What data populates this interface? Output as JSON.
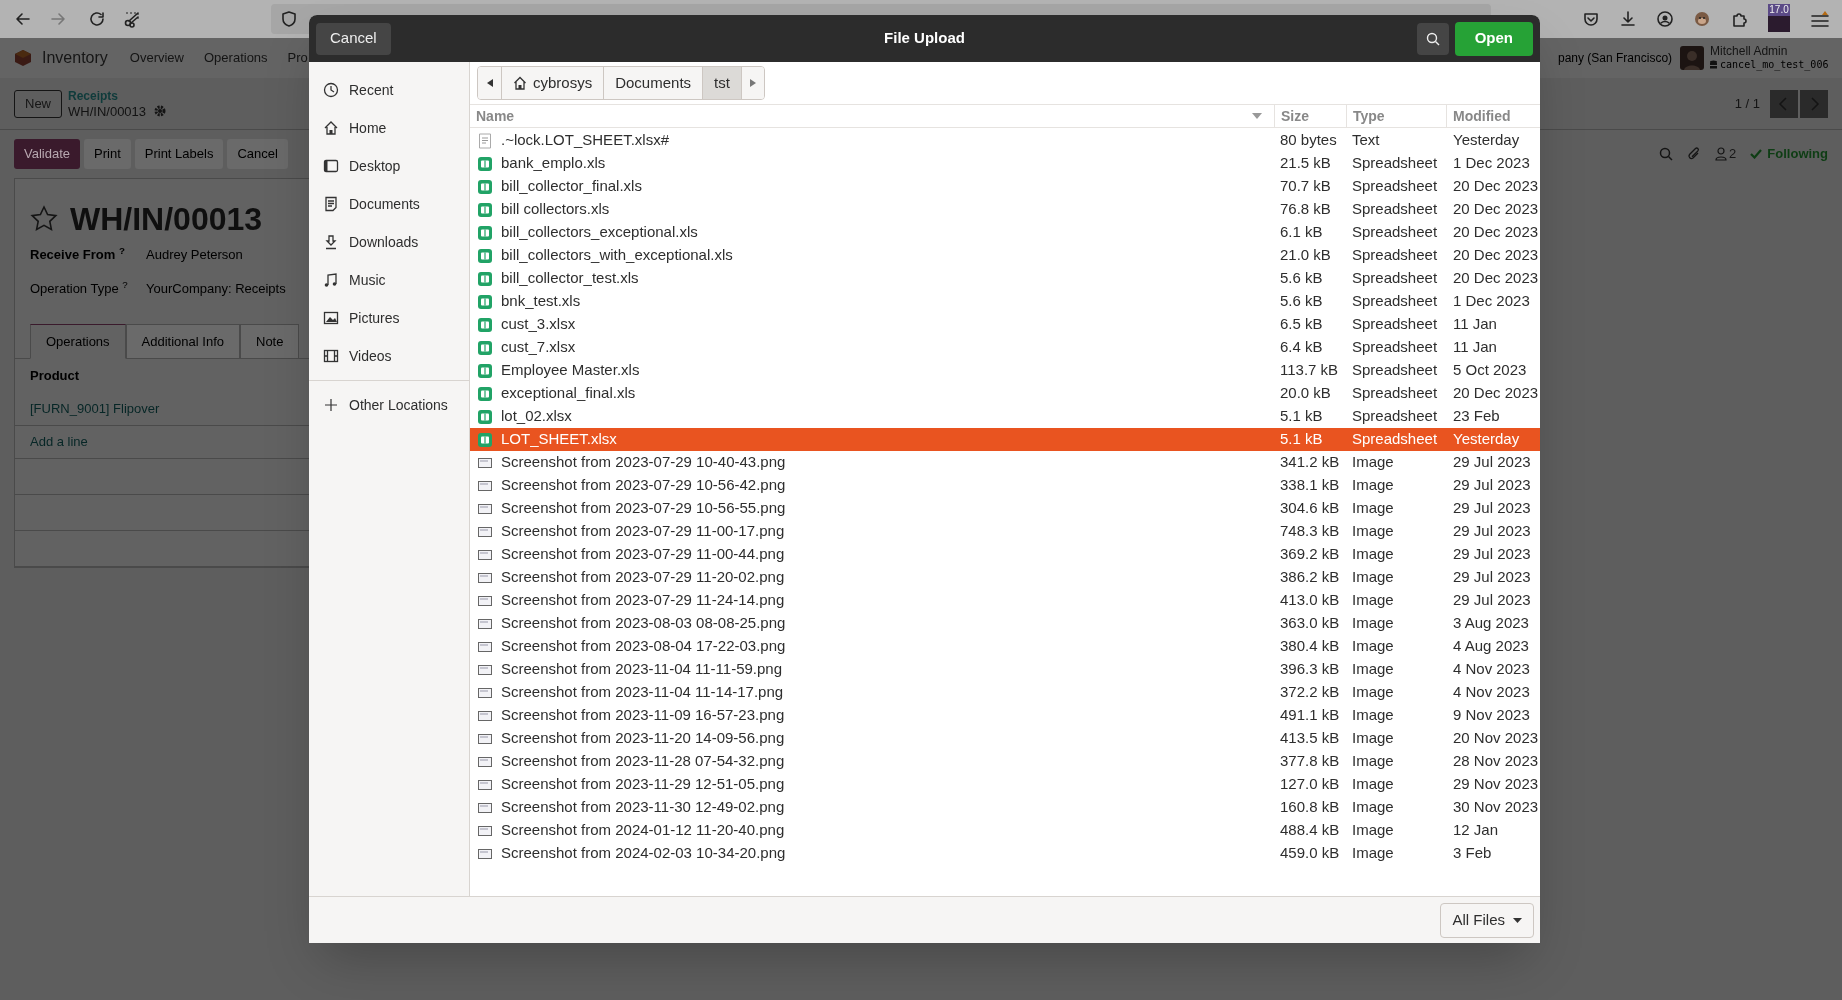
{
  "browser": {
    "extension_badge": "17.0"
  },
  "app": {
    "name": "Inventory",
    "menu": [
      "Overview",
      "Operations",
      "Pro"
    ],
    "company": "pany (San Francisco)",
    "user": {
      "name": "Mitchell Admin",
      "database": "cancel_mo_test_006"
    },
    "new_button": "New",
    "breadcrumb": {
      "parent": "Receipts",
      "current": "WH/IN/00013"
    },
    "pager": "1 / 1",
    "actions": [
      {
        "label": "Validate",
        "kind": "primary"
      },
      {
        "label": "Print",
        "kind": "secondary"
      },
      {
        "label": "Print Labels",
        "kind": "secondary"
      },
      {
        "label": "Cancel",
        "kind": "secondary"
      }
    ],
    "followers_count": "2",
    "follow_label": "Following",
    "record": {
      "title": "WH/IN/00013",
      "starred": false,
      "fields": [
        {
          "label": "Receive From",
          "help": "?",
          "value": "Audrey Peterson",
          "strong": true
        },
        {
          "label": "Operation Type",
          "help": "?",
          "value": "YourCompany: Receipts",
          "strong": false
        }
      ],
      "tabs": [
        {
          "label": "Operations",
          "selected": true
        },
        {
          "label": "Additional Info",
          "selected": false
        },
        {
          "label": "Note",
          "selected": false
        }
      ],
      "table": {
        "column": "Product",
        "rows": [
          "[FURN_9001] Flipover"
        ],
        "add_line": "Add a line"
      }
    }
  },
  "dialog": {
    "title": "File Upload",
    "cancel": "Cancel",
    "open": "Open",
    "places": [
      {
        "label": "Recent",
        "kind": "recent"
      },
      {
        "label": "Home",
        "kind": "home"
      },
      {
        "label": "Desktop",
        "kind": "desktop"
      },
      {
        "label": "Documents",
        "kind": "documents"
      },
      {
        "label": "Downloads",
        "kind": "downloads"
      },
      {
        "label": "Music",
        "kind": "music"
      },
      {
        "label": "Pictures",
        "kind": "pictures"
      },
      {
        "label": "Videos",
        "kind": "videos"
      }
    ],
    "other_locations": "Other Locations",
    "path": [
      {
        "label": "cybrosys",
        "kind": "home",
        "selected": false
      },
      {
        "label": "Documents",
        "kind": "folder",
        "selected": false
      },
      {
        "label": "tst",
        "kind": "folder",
        "selected": true
      }
    ],
    "columns": [
      "Name",
      "Size",
      "Type",
      "Modified"
    ],
    "files": [
      {
        "name": ".~lock.LOT_SHEET.xlsx#",
        "size": "80 bytes",
        "type": "Text",
        "modified": "Yesterday",
        "kind": "text",
        "selected": false
      },
      {
        "name": "bank_emplo.xls",
        "size": "21.5 kB",
        "type": "Spreadsheet",
        "modified": "1 Dec 2023",
        "kind": "spreadsheet",
        "selected": false
      },
      {
        "name": "bill_collector_final.xls",
        "size": "70.7 kB",
        "type": "Spreadsheet",
        "modified": "20 Dec 2023",
        "kind": "spreadsheet",
        "selected": false
      },
      {
        "name": "bill collectors.xls",
        "size": "76.8 kB",
        "type": "Spreadsheet",
        "modified": "20 Dec 2023",
        "kind": "spreadsheet",
        "selected": false
      },
      {
        "name": "bill_collectors_exceptional.xls",
        "size": "6.1 kB",
        "type": "Spreadsheet",
        "modified": "20 Dec 2023",
        "kind": "spreadsheet",
        "selected": false
      },
      {
        "name": "bill_collectors_with_exceptional.xls",
        "size": "21.0 kB",
        "type": "Spreadsheet",
        "modified": "20 Dec 2023",
        "kind": "spreadsheet",
        "selected": false
      },
      {
        "name": "bill_collector_test.xls",
        "size": "5.6 kB",
        "type": "Spreadsheet",
        "modified": "20 Dec 2023",
        "kind": "spreadsheet",
        "selected": false
      },
      {
        "name": "bnk_test.xls",
        "size": "5.6 kB",
        "type": "Spreadsheet",
        "modified": "1 Dec 2023",
        "kind": "spreadsheet",
        "selected": false
      },
      {
        "name": "cust_3.xlsx",
        "size": "6.5 kB",
        "type": "Spreadsheet",
        "modified": "11 Jan",
        "kind": "spreadsheet",
        "selected": false
      },
      {
        "name": "cust_7.xlsx",
        "size": "6.4 kB",
        "type": "Spreadsheet",
        "modified": "11 Jan",
        "kind": "spreadsheet",
        "selected": false
      },
      {
        "name": "Employee Master.xls",
        "size": "113.7 kB",
        "type": "Spreadsheet",
        "modified": "5 Oct 2023",
        "kind": "spreadsheet",
        "selected": false
      },
      {
        "name": "exceptional_final.xls",
        "size": "20.0 kB",
        "type": "Spreadsheet",
        "modified": "20 Dec 2023",
        "kind": "spreadsheet",
        "selected": false
      },
      {
        "name": "lot_02.xlsx",
        "size": "5.1 kB",
        "type": "Spreadsheet",
        "modified": "23 Feb",
        "kind": "spreadsheet",
        "selected": false
      },
      {
        "name": "LOT_SHEET.xlsx",
        "size": "5.1 kB",
        "type": "Spreadsheet",
        "modified": "Yesterday",
        "kind": "spreadsheet",
        "selected": true
      },
      {
        "name": "Screenshot from 2023-07-29 10-40-43.png",
        "size": "341.2 kB",
        "type": "Image",
        "modified": "29 Jul 2023",
        "kind": "image",
        "selected": false
      },
      {
        "name": "Screenshot from 2023-07-29 10-56-42.png",
        "size": "338.1 kB",
        "type": "Image",
        "modified": "29 Jul 2023",
        "kind": "image",
        "selected": false
      },
      {
        "name": "Screenshot from 2023-07-29 10-56-55.png",
        "size": "304.6 kB",
        "type": "Image",
        "modified": "29 Jul 2023",
        "kind": "image",
        "selected": false
      },
      {
        "name": "Screenshot from 2023-07-29 11-00-17.png",
        "size": "748.3 kB",
        "type": "Image",
        "modified": "29 Jul 2023",
        "kind": "image",
        "selected": false
      },
      {
        "name": "Screenshot from 2023-07-29 11-00-44.png",
        "size": "369.2 kB",
        "type": "Image",
        "modified": "29 Jul 2023",
        "kind": "image",
        "selected": false
      },
      {
        "name": "Screenshot from 2023-07-29 11-20-02.png",
        "size": "386.2 kB",
        "type": "Image",
        "modified": "29 Jul 2023",
        "kind": "image",
        "selected": false
      },
      {
        "name": "Screenshot from 2023-07-29 11-24-14.png",
        "size": "413.0 kB",
        "type": "Image",
        "modified": "29 Jul 2023",
        "kind": "image",
        "selected": false
      },
      {
        "name": "Screenshot from 2023-08-03 08-08-25.png",
        "size": "363.0 kB",
        "type": "Image",
        "modified": "3 Aug 2023",
        "kind": "image",
        "selected": false
      },
      {
        "name": "Screenshot from 2023-08-04 17-22-03.png",
        "size": "380.4 kB",
        "type": "Image",
        "modified": "4 Aug 2023",
        "kind": "image",
        "selected": false
      },
      {
        "name": "Screenshot from 2023-11-04 11-11-59.png",
        "size": "396.3 kB",
        "type": "Image",
        "modified": "4 Nov 2023",
        "kind": "image",
        "selected": false
      },
      {
        "name": "Screenshot from 2023-11-04 11-14-17.png",
        "size": "372.2 kB",
        "type": "Image",
        "modified": "4 Nov 2023",
        "kind": "image",
        "selected": false
      },
      {
        "name": "Screenshot from 2023-11-09 16-57-23.png",
        "size": "491.1 kB",
        "type": "Image",
        "modified": "9 Nov 2023",
        "kind": "image",
        "selected": false
      },
      {
        "name": "Screenshot from 2023-11-20 14-09-56.png",
        "size": "413.5 kB",
        "type": "Image",
        "modified": "20 Nov 2023",
        "kind": "image",
        "selected": false
      },
      {
        "name": "Screenshot from 2023-11-28 07-54-32.png",
        "size": "377.8 kB",
        "type": "Image",
        "modified": "28 Nov 2023",
        "kind": "image",
        "selected": false
      },
      {
        "name": "Screenshot from 2023-11-29 12-51-05.png",
        "size": "127.0 kB",
        "type": "Image",
        "modified": "29 Nov 2023",
        "kind": "image",
        "selected": false
      },
      {
        "name": "Screenshot from 2023-11-30 12-49-02.png",
        "size": "160.8 kB",
        "type": "Image",
        "modified": "30 Nov 2023",
        "kind": "image",
        "selected": false
      },
      {
        "name": "Screenshot from 2024-01-12 11-20-40.png",
        "size": "488.4 kB",
        "type": "Image",
        "modified": "12 Jan",
        "kind": "image",
        "selected": false
      },
      {
        "name": "Screenshot from 2024-02-03 10-34-20.png",
        "size": "459.0 kB",
        "type": "Image",
        "modified": "3 Feb",
        "kind": "image",
        "selected": false
      }
    ],
    "filter": "All Files"
  }
}
